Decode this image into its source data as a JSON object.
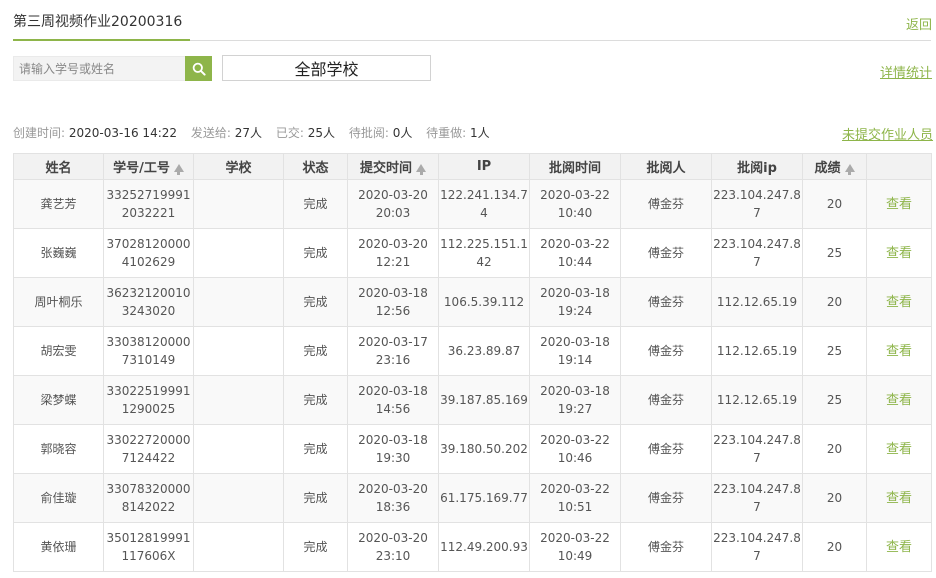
{
  "page": {
    "title": "第三周视频作业20200316",
    "back_label": "返回"
  },
  "toolbar": {
    "search_placeholder": "请输入学号或姓名",
    "school_select": "全部学校",
    "detail_stats_label": "详情统计"
  },
  "info": {
    "created_label": "创建时间:",
    "created_value": "2020-03-16 14:22",
    "sent_label": "发送给:",
    "sent_value": "27人",
    "submitted_label": "已交:",
    "submitted_value": "25人",
    "pending_review_label": "待批阅:",
    "pending_review_value": "0人",
    "redo_label": "待重做:",
    "redo_value": "1人",
    "unsubmitted_link": "未提交作业人员"
  },
  "table": {
    "headers": [
      "姓名",
      "学号/工号",
      "学校",
      "状态",
      "提交时间",
      "IP",
      "批阅时间",
      "批阅人",
      "批阅ip",
      "成绩",
      ""
    ],
    "rows": [
      {
        "name": "龚艺芳",
        "id_line1": "33252719991",
        "id_line2": "2032221",
        "school": "",
        "status": "完成",
        "submit_date": "2020-03-20",
        "submit_time": "20:03",
        "ip_line1": "122.241.134.7",
        "ip_line2": "4",
        "review_date": "2020-03-22",
        "review_time": "10:40",
        "reviewer": "傅金芬",
        "review_ip_line1": "223.104.247.8",
        "review_ip_line2": "7",
        "score": "20",
        "action": "查看"
      },
      {
        "name": "张巍巍",
        "id_line1": "37028120000",
        "id_line2": "4102629",
        "school": "",
        "status": "完成",
        "submit_date": "2020-03-20",
        "submit_time": "12:21",
        "ip_line1": "112.225.151.1",
        "ip_line2": "42",
        "review_date": "2020-03-22",
        "review_time": "10:44",
        "reviewer": "傅金芬",
        "review_ip_line1": "223.104.247.8",
        "review_ip_line2": "7",
        "score": "25",
        "action": "查看"
      },
      {
        "name": "周叶桐乐",
        "id_line1": "36232120010",
        "id_line2": "3243020",
        "school": "",
        "status": "完成",
        "submit_date": "2020-03-18",
        "submit_time": "12:56",
        "ip_line1": "106.5.39.112",
        "ip_line2": "",
        "review_date": "2020-03-18",
        "review_time": "19:24",
        "reviewer": "傅金芬",
        "review_ip_line1": "112.12.65.19",
        "review_ip_line2": "",
        "score": "20",
        "action": "查看"
      },
      {
        "name": "胡宏雯",
        "id_line1": "33038120000",
        "id_line2": "7310149",
        "school": "",
        "status": "完成",
        "submit_date": "2020-03-17",
        "submit_time": "23:16",
        "ip_line1": "36.23.89.87",
        "ip_line2": "",
        "review_date": "2020-03-18",
        "review_time": "19:14",
        "reviewer": "傅金芬",
        "review_ip_line1": "112.12.65.19",
        "review_ip_line2": "",
        "score": "25",
        "action": "查看"
      },
      {
        "name": "梁梦蝶",
        "id_line1": "33022519991",
        "id_line2": "1290025",
        "school": "",
        "status": "完成",
        "submit_date": "2020-03-18",
        "submit_time": "14:56",
        "ip_line1": "39.187.85.169",
        "ip_line2": "",
        "review_date": "2020-03-18",
        "review_time": "19:27",
        "reviewer": "傅金芬",
        "review_ip_line1": "112.12.65.19",
        "review_ip_line2": "",
        "score": "25",
        "action": "查看"
      },
      {
        "name": "郭晓容",
        "id_line1": "33022720000",
        "id_line2": "7124422",
        "school": "",
        "status": "完成",
        "submit_date": "2020-03-18",
        "submit_time": "19:30",
        "ip_line1": "39.180.50.202",
        "ip_line2": "",
        "review_date": "2020-03-22",
        "review_time": "10:46",
        "reviewer": "傅金芬",
        "review_ip_line1": "223.104.247.8",
        "review_ip_line2": "7",
        "score": "20",
        "action": "查看"
      },
      {
        "name": "俞佳璇",
        "id_line1": "33078320000",
        "id_line2": "8142022",
        "school": "",
        "status": "完成",
        "submit_date": "2020-03-20",
        "submit_time": "18:36",
        "ip_line1": "61.175.169.77",
        "ip_line2": "",
        "review_date": "2020-03-22",
        "review_time": "10:51",
        "reviewer": "傅金芬",
        "review_ip_line1": "223.104.247.8",
        "review_ip_line2": "7",
        "score": "20",
        "action": "查看"
      },
      {
        "name": "黄依珊",
        "id_line1": "35012819991",
        "id_line2": "117606X",
        "school": "",
        "status": "完成",
        "submit_date": "2020-03-20",
        "submit_time": "23:10",
        "ip_line1": "112.49.200.93",
        "ip_line2": "",
        "review_date": "2020-03-22",
        "review_time": "10:49",
        "reviewer": "傅金芬",
        "review_ip_line1": "223.104.247.8",
        "review_ip_line2": "7",
        "score": "20",
        "action": "查看"
      }
    ]
  },
  "colors": {
    "accent": "#8eb54a",
    "header_bg": "#f2f2f2",
    "border": "#e2e2e2"
  }
}
